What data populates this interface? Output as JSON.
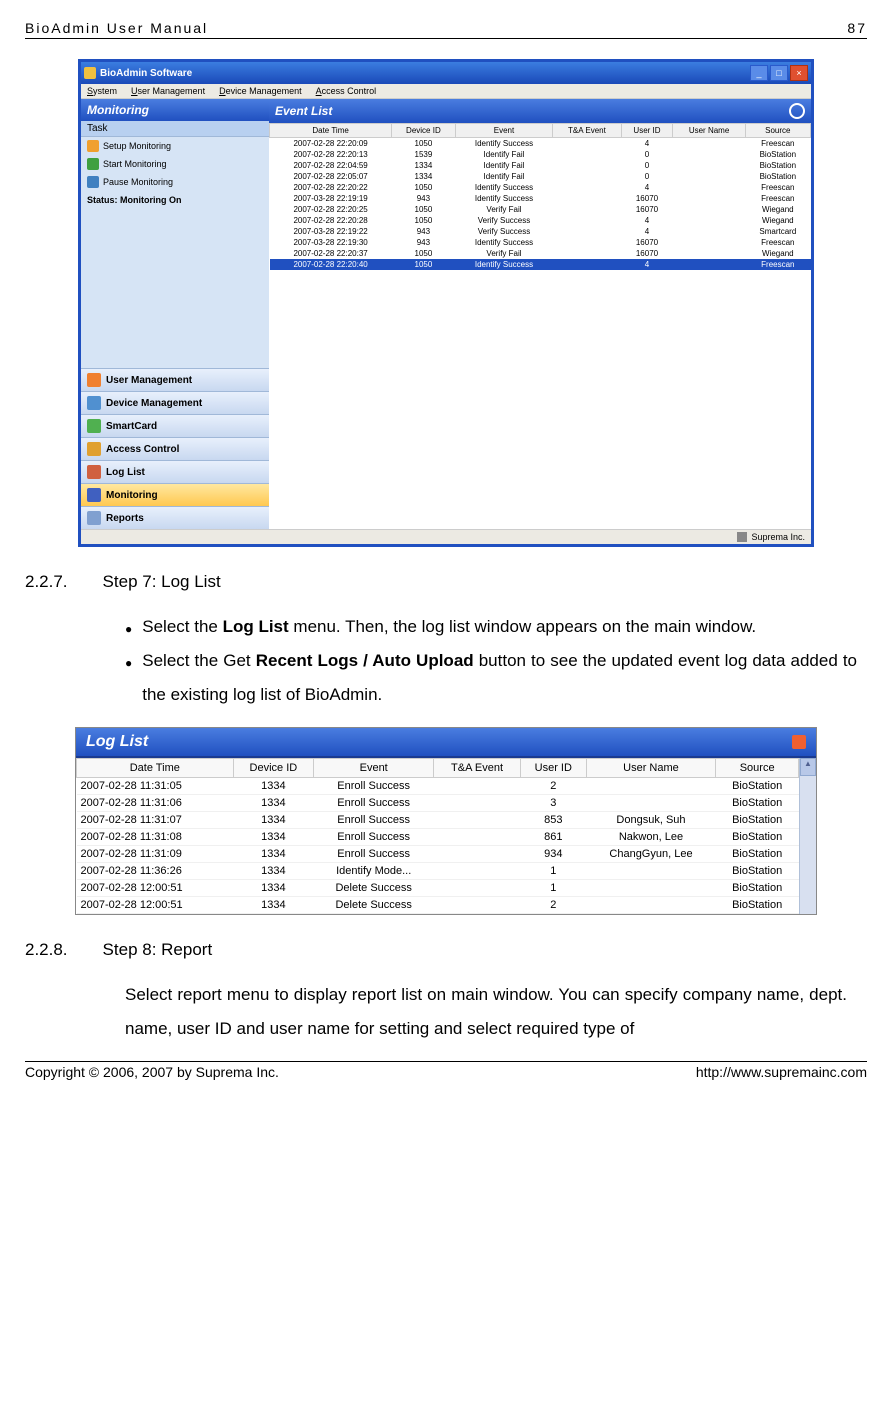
{
  "header": {
    "title": "BioAdmin User Manual",
    "page": "87"
  },
  "footer": {
    "copyright": "Copyright © 2006, 2007 by Suprema Inc.",
    "url": "http://www.supremainc.com"
  },
  "win1": {
    "title": "BioAdmin Software",
    "menus": [
      "System",
      "User Management",
      "Device Management",
      "Access Control"
    ],
    "sidebar_title": "Monitoring",
    "task_label": "Task",
    "tasks": [
      "Setup Monitoring",
      "Start Monitoring",
      "Pause Monitoring"
    ],
    "status": "Status: Monitoring On",
    "nav": [
      "User Management",
      "Device Management",
      "SmartCard",
      "Access Control",
      "Log List",
      "Monitoring",
      "Reports"
    ],
    "main_title": "Event List",
    "columns": [
      "Date Time",
      "Device ID",
      "Event",
      "T&A Event",
      "User ID",
      "User Name",
      "Source"
    ],
    "rows": [
      [
        "2007-02-28 22:20:09",
        "1050",
        "Identify Success",
        "",
        "4",
        "",
        "Freescan"
      ],
      [
        "2007-02-28 22:20:13",
        "1539",
        "Identify Fail",
        "",
        "0",
        "",
        "BioStation"
      ],
      [
        "2007-02-28 22:04:59",
        "1334",
        "Identify Fail",
        "",
        "0",
        "",
        "BioStation"
      ],
      [
        "2007-02-28 22:05:07",
        "1334",
        "Identify Fail",
        "",
        "0",
        "",
        "BioStation"
      ],
      [
        "2007-02-28 22:20:22",
        "1050",
        "Identify Success",
        "",
        "4",
        "",
        "Freescan"
      ],
      [
        "2007-03-28 22:19:19",
        "943",
        "Identify Success",
        "",
        "16070",
        "",
        "Freescan"
      ],
      [
        "2007-02-28 22:20:25",
        "1050",
        "Verify Fail",
        "",
        "16070",
        "",
        "Wiegand"
      ],
      [
        "2007-02-28 22:20:28",
        "1050",
        "Verify Success",
        "",
        "4",
        "",
        "Wiegand"
      ],
      [
        "2007-03-28 22:19:22",
        "943",
        "Verify Success",
        "",
        "4",
        "",
        "Smartcard"
      ],
      [
        "2007-03-28 22:19:30",
        "943",
        "Identify Success",
        "",
        "16070",
        "",
        "Freescan"
      ],
      [
        "2007-02-28 22:20:37",
        "1050",
        "Verify Fail",
        "",
        "16070",
        "",
        "Wiegand"
      ],
      [
        "2007-02-28 22:20:40",
        "1050",
        "Identify Success",
        "",
        "4",
        "",
        "Freescan"
      ]
    ],
    "status_text": "Suprema Inc."
  },
  "sec227": {
    "num": "2.2.7.",
    "title": "Step 7: Log List"
  },
  "bullets1": {
    "b1a": "Select the ",
    "b1b": "Log List",
    "b1c": " menu. Then, the log list window appears on the main window.",
    "b2a": "Select the Get ",
    "b2b": "Recent Logs / Auto Upload",
    "b2c": " button to see the updated event log data added to the existing log list of BioAdmin."
  },
  "win2": {
    "title": "Log List",
    "columns": [
      "Date Time",
      "Device ID",
      "Event",
      "T&A Event",
      "User ID",
      "User Name",
      "Source"
    ],
    "rows": [
      [
        "2007-02-28 11:31:05",
        "1334",
        "Enroll Success",
        "",
        "2",
        "",
        "BioStation"
      ],
      [
        "2007-02-28 11:31:06",
        "1334",
        "Enroll Success",
        "",
        "3",
        "",
        "BioStation"
      ],
      [
        "2007-02-28 11:31:07",
        "1334",
        "Enroll Success",
        "",
        "853",
        "Dongsuk, Suh",
        "BioStation"
      ],
      [
        "2007-02-28 11:31:08",
        "1334",
        "Enroll Success",
        "",
        "861",
        "Nakwon, Lee",
        "BioStation"
      ],
      [
        "2007-02-28 11:31:09",
        "1334",
        "Enroll Success",
        "",
        "934",
        "ChangGyun, Lee",
        "BioStation"
      ],
      [
        "2007-02-28 11:36:26",
        "1334",
        "Identify Mode...",
        "",
        "1",
        "",
        "BioStation"
      ],
      [
        "2007-02-28 12:00:51",
        "1334",
        "Delete Success",
        "",
        "1",
        "",
        "BioStation"
      ],
      [
        "2007-02-28 12:00:51",
        "1334",
        "Delete Success",
        "",
        "2",
        "",
        "BioStation"
      ]
    ]
  },
  "sec228": {
    "num": "2.2.8.",
    "title": "Step 8: Report"
  },
  "para228": "Select report menu to display report list on main window. You can specify company name, dept. name, user ID and user name for setting and select required type of"
}
